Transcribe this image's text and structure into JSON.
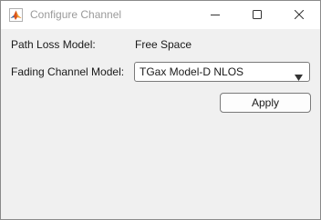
{
  "window": {
    "title": "Configure Channel",
    "app_icon": "matlab-icon",
    "controls": [
      "minimize-icon",
      "maximize-icon",
      "close-icon"
    ]
  },
  "form": {
    "path_loss_label": "Path Loss Model:",
    "path_loss_value": "Free Space",
    "fading_label": "Fading Channel Model:",
    "fading_selected": "TGax Model-D NLOS",
    "apply_label": "Apply"
  },
  "colors": {
    "background": "#f0f0f0",
    "titlebar": "#ffffff",
    "title_text": "#9a9a9a",
    "border": "#7a7a7a"
  }
}
